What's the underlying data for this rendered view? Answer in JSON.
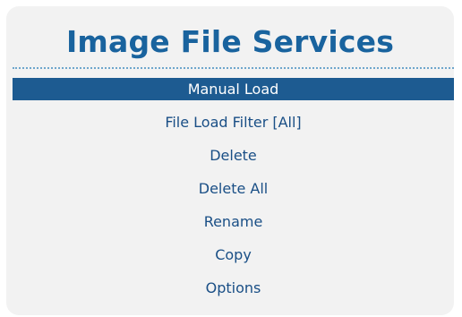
{
  "header": {
    "title": "Image File Services"
  },
  "menu": {
    "items": [
      {
        "label": "Manual Load",
        "selected": true
      },
      {
        "label": "File Load Filter [All]",
        "selected": false
      },
      {
        "label": "Delete",
        "selected": false
      },
      {
        "label": "Delete All",
        "selected": false
      },
      {
        "label": "Rename",
        "selected": false
      },
      {
        "label": "Copy",
        "selected": false
      },
      {
        "label": "Options",
        "selected": false
      }
    ]
  },
  "colors": {
    "title": "#19639e",
    "panel_background": "#f2f2f2",
    "selection_background": "#1d5b91",
    "selection_text": "#ffffff",
    "item_text": "#1a4f86",
    "divider": "#6ea6cc"
  }
}
